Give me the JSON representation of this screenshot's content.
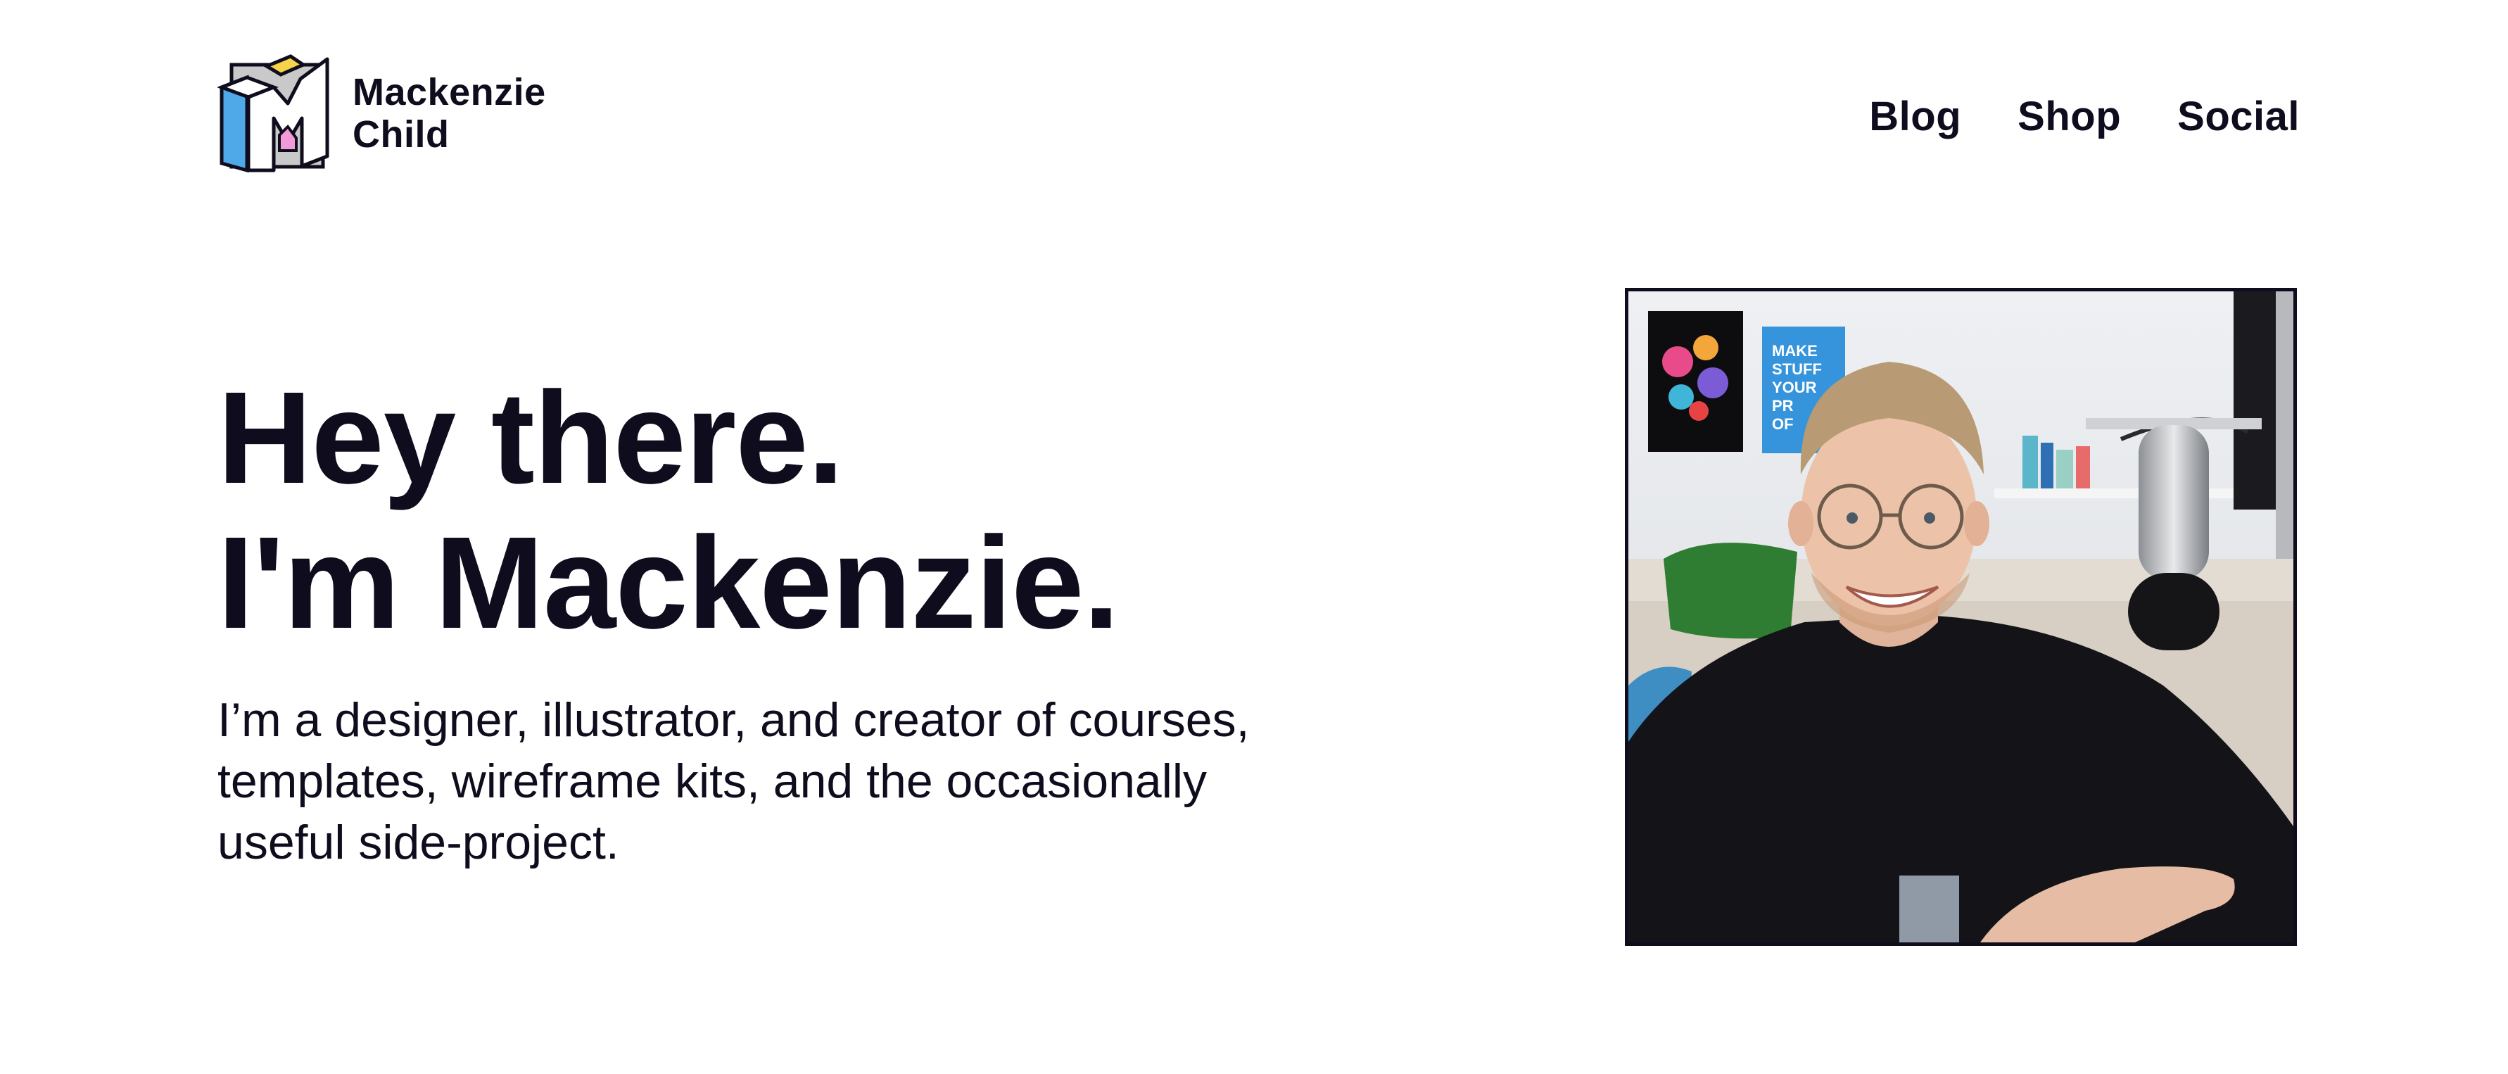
{
  "brand": {
    "name_line1": "Mackenzie",
    "name_line2": "Child",
    "logo_icon": "m-cube-logo-icon",
    "logo_colors": {
      "blue": "#4fa8e8",
      "yellow": "#f5d34a",
      "pink": "#f29ad8",
      "gray": "#c9c9c9"
    }
  },
  "nav": {
    "items": [
      {
        "label": "Blog"
      },
      {
        "label": "Shop"
      },
      {
        "label": "Social"
      }
    ]
  },
  "hero": {
    "title_line1": "Hey there.",
    "title_line2": "I'm Mackenzie.",
    "intro": "I’m a designer, illustrator, and creator of courses, templates, wireframe kits, and the occasionally useful side-project.",
    "photo_alt": "Smiling man with glasses in a studio next to a microphone",
    "poster_text": "MAKE STUFF YOUR PR OF"
  },
  "colors": {
    "text": "#0f0d1d",
    "background": "#ffffff"
  }
}
